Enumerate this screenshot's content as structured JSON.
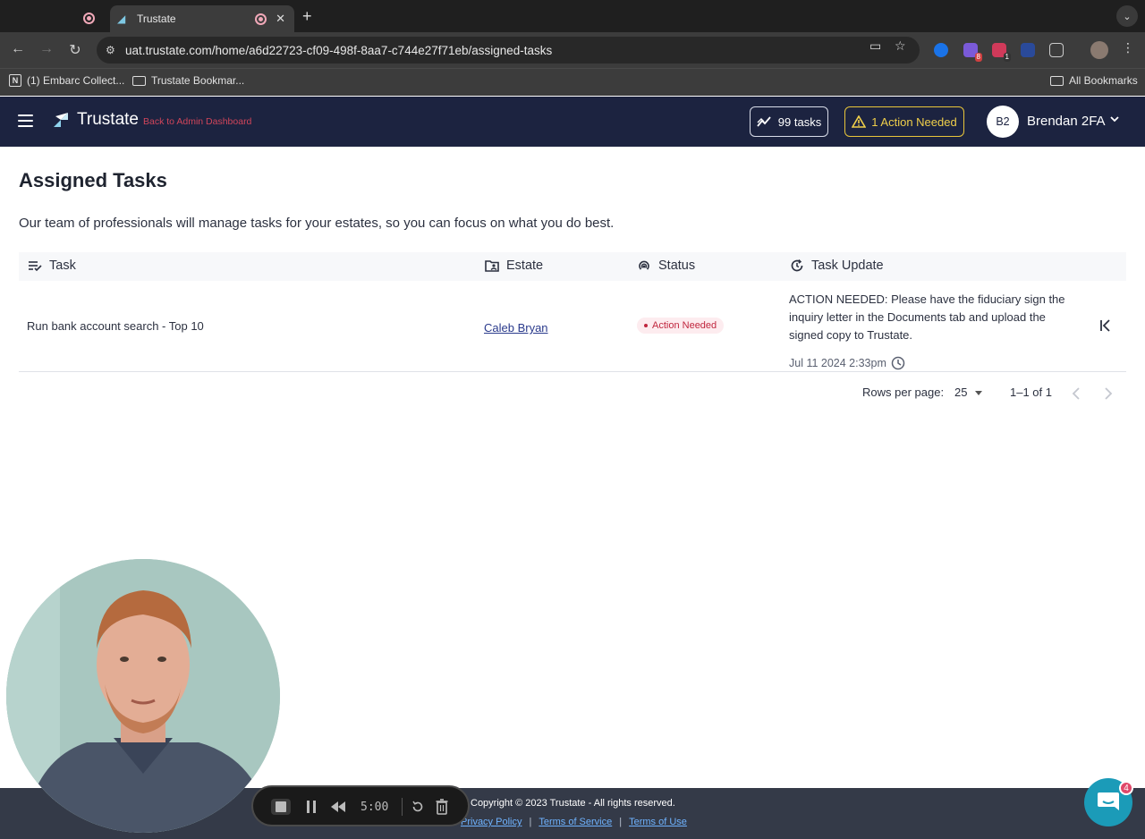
{
  "browser": {
    "tabs": [
      {
        "title": ""
      },
      {
        "title": "Trustate"
      }
    ],
    "url": "uat.trustate.com/home/a6d22723-cf09-498f-8aa7-c744e27f71eb/assigned-tasks",
    "extension_badges": [
      "8",
      "1"
    ],
    "bookmarks": [
      {
        "label": "(1) Embarc Collect..."
      },
      {
        "label": "Trustate Bookmar..."
      }
    ],
    "all_bookmarks_label": "All Bookmarks"
  },
  "header": {
    "brand": "Trustate",
    "back_link": "Back to Admin Dashboard",
    "tasks_count_label": "99 tasks",
    "action_needed_label": "1 Action Needed",
    "user_initials": "B2",
    "user_name": "Brendan 2FA",
    "accent_color": "#1c2340",
    "warning_color": "#e8c53a"
  },
  "page": {
    "title": "Assigned Tasks",
    "description": "Our team of professionals will manage tasks for your estates, so you can focus on what you do best."
  },
  "table": {
    "columns": [
      {
        "label": "Task",
        "icon": "checklist-icon"
      },
      {
        "label": "Estate",
        "icon": "folder-user-icon"
      },
      {
        "label": "Status",
        "icon": "signal-icon"
      },
      {
        "label": "Task Update",
        "icon": "refresh-clock-icon"
      }
    ],
    "rows": [
      {
        "task": "Run bank account search - Top 10",
        "estate": "Caleb Bryan",
        "status": "Action Needed",
        "update_lines": [
          "ACTION NEEDED: Please have the fiduciary sign the",
          "inquiry letter in the Documents tab and upload the",
          "signed copy to Trustate."
        ],
        "update_time": "Jul 11 2024 2:33pm"
      }
    ],
    "pagination": {
      "rows_per_page_label": "Rows per page:",
      "rows_per_page_value": "25",
      "range": "1–1 of 1"
    }
  },
  "footer": {
    "copyright": "Copyright © 2023 Trustate - All rights reserved.",
    "links": [
      "Privacy Policy",
      "Terms of Service",
      "Terms of Use"
    ],
    "separator": "|"
  },
  "recorder": {
    "timer": "5:00"
  },
  "chat": {
    "badge": "4"
  }
}
